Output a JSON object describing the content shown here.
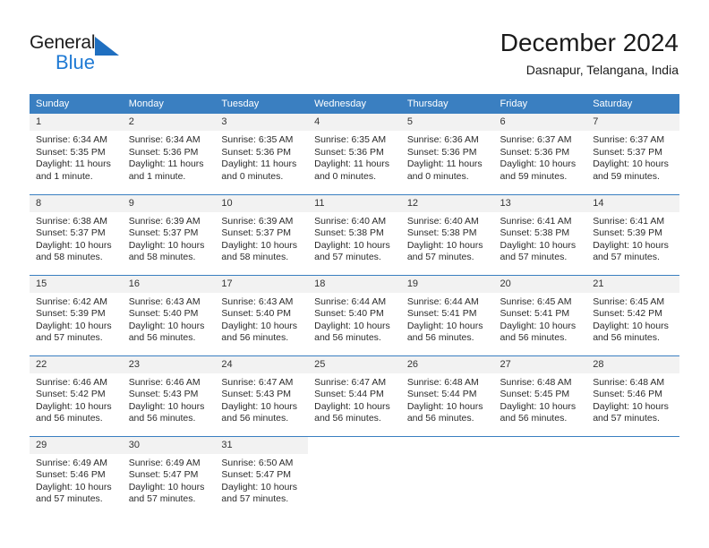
{
  "brand": {
    "name_part1": "General",
    "name_part2": "Blue",
    "accent_color": "#1f7ad4",
    "triangle_color": "#1f6fc0"
  },
  "header": {
    "month_title": "December 2024",
    "location": "Dasnapur, Telangana, India"
  },
  "calendar": {
    "header_bg": "#3a7fc1",
    "daynum_bg": "#f2f2f2",
    "weekday_labels": [
      "Sunday",
      "Monday",
      "Tuesday",
      "Wednesday",
      "Thursday",
      "Friday",
      "Saturday"
    ],
    "weeks": [
      [
        {
          "day": "1",
          "sunrise": "Sunrise: 6:34 AM",
          "sunset": "Sunset: 5:35 PM",
          "daylight_line1": "Daylight: 11 hours",
          "daylight_line2": "and 1 minute."
        },
        {
          "day": "2",
          "sunrise": "Sunrise: 6:34 AM",
          "sunset": "Sunset: 5:36 PM",
          "daylight_line1": "Daylight: 11 hours",
          "daylight_line2": "and 1 minute."
        },
        {
          "day": "3",
          "sunrise": "Sunrise: 6:35 AM",
          "sunset": "Sunset: 5:36 PM",
          "daylight_line1": "Daylight: 11 hours",
          "daylight_line2": "and 0 minutes."
        },
        {
          "day": "4",
          "sunrise": "Sunrise: 6:35 AM",
          "sunset": "Sunset: 5:36 PM",
          "daylight_line1": "Daylight: 11 hours",
          "daylight_line2": "and 0 minutes."
        },
        {
          "day": "5",
          "sunrise": "Sunrise: 6:36 AM",
          "sunset": "Sunset: 5:36 PM",
          "daylight_line1": "Daylight: 11 hours",
          "daylight_line2": "and 0 minutes."
        },
        {
          "day": "6",
          "sunrise": "Sunrise: 6:37 AM",
          "sunset": "Sunset: 5:36 PM",
          "daylight_line1": "Daylight: 10 hours",
          "daylight_line2": "and 59 minutes."
        },
        {
          "day": "7",
          "sunrise": "Sunrise: 6:37 AM",
          "sunset": "Sunset: 5:37 PM",
          "daylight_line1": "Daylight: 10 hours",
          "daylight_line2": "and 59 minutes."
        }
      ],
      [
        {
          "day": "8",
          "sunrise": "Sunrise: 6:38 AM",
          "sunset": "Sunset: 5:37 PM",
          "daylight_line1": "Daylight: 10 hours",
          "daylight_line2": "and 58 minutes."
        },
        {
          "day": "9",
          "sunrise": "Sunrise: 6:39 AM",
          "sunset": "Sunset: 5:37 PM",
          "daylight_line1": "Daylight: 10 hours",
          "daylight_line2": "and 58 minutes."
        },
        {
          "day": "10",
          "sunrise": "Sunrise: 6:39 AM",
          "sunset": "Sunset: 5:37 PM",
          "daylight_line1": "Daylight: 10 hours",
          "daylight_line2": "and 58 minutes."
        },
        {
          "day": "11",
          "sunrise": "Sunrise: 6:40 AM",
          "sunset": "Sunset: 5:38 PM",
          "daylight_line1": "Daylight: 10 hours",
          "daylight_line2": "and 57 minutes."
        },
        {
          "day": "12",
          "sunrise": "Sunrise: 6:40 AM",
          "sunset": "Sunset: 5:38 PM",
          "daylight_line1": "Daylight: 10 hours",
          "daylight_line2": "and 57 minutes."
        },
        {
          "day": "13",
          "sunrise": "Sunrise: 6:41 AM",
          "sunset": "Sunset: 5:38 PM",
          "daylight_line1": "Daylight: 10 hours",
          "daylight_line2": "and 57 minutes."
        },
        {
          "day": "14",
          "sunrise": "Sunrise: 6:41 AM",
          "sunset": "Sunset: 5:39 PM",
          "daylight_line1": "Daylight: 10 hours",
          "daylight_line2": "and 57 minutes."
        }
      ],
      [
        {
          "day": "15",
          "sunrise": "Sunrise: 6:42 AM",
          "sunset": "Sunset: 5:39 PM",
          "daylight_line1": "Daylight: 10 hours",
          "daylight_line2": "and 57 minutes."
        },
        {
          "day": "16",
          "sunrise": "Sunrise: 6:43 AM",
          "sunset": "Sunset: 5:40 PM",
          "daylight_line1": "Daylight: 10 hours",
          "daylight_line2": "and 56 minutes."
        },
        {
          "day": "17",
          "sunrise": "Sunrise: 6:43 AM",
          "sunset": "Sunset: 5:40 PM",
          "daylight_line1": "Daylight: 10 hours",
          "daylight_line2": "and 56 minutes."
        },
        {
          "day": "18",
          "sunrise": "Sunrise: 6:44 AM",
          "sunset": "Sunset: 5:40 PM",
          "daylight_line1": "Daylight: 10 hours",
          "daylight_line2": "and 56 minutes."
        },
        {
          "day": "19",
          "sunrise": "Sunrise: 6:44 AM",
          "sunset": "Sunset: 5:41 PM",
          "daylight_line1": "Daylight: 10 hours",
          "daylight_line2": "and 56 minutes."
        },
        {
          "day": "20",
          "sunrise": "Sunrise: 6:45 AM",
          "sunset": "Sunset: 5:41 PM",
          "daylight_line1": "Daylight: 10 hours",
          "daylight_line2": "and 56 minutes."
        },
        {
          "day": "21",
          "sunrise": "Sunrise: 6:45 AM",
          "sunset": "Sunset: 5:42 PM",
          "daylight_line1": "Daylight: 10 hours",
          "daylight_line2": "and 56 minutes."
        }
      ],
      [
        {
          "day": "22",
          "sunrise": "Sunrise: 6:46 AM",
          "sunset": "Sunset: 5:42 PM",
          "daylight_line1": "Daylight: 10 hours",
          "daylight_line2": "and 56 minutes."
        },
        {
          "day": "23",
          "sunrise": "Sunrise: 6:46 AM",
          "sunset": "Sunset: 5:43 PM",
          "daylight_line1": "Daylight: 10 hours",
          "daylight_line2": "and 56 minutes."
        },
        {
          "day": "24",
          "sunrise": "Sunrise: 6:47 AM",
          "sunset": "Sunset: 5:43 PM",
          "daylight_line1": "Daylight: 10 hours",
          "daylight_line2": "and 56 minutes."
        },
        {
          "day": "25",
          "sunrise": "Sunrise: 6:47 AM",
          "sunset": "Sunset: 5:44 PM",
          "daylight_line1": "Daylight: 10 hours",
          "daylight_line2": "and 56 minutes."
        },
        {
          "day": "26",
          "sunrise": "Sunrise: 6:48 AM",
          "sunset": "Sunset: 5:44 PM",
          "daylight_line1": "Daylight: 10 hours",
          "daylight_line2": "and 56 minutes."
        },
        {
          "day": "27",
          "sunrise": "Sunrise: 6:48 AM",
          "sunset": "Sunset: 5:45 PM",
          "daylight_line1": "Daylight: 10 hours",
          "daylight_line2": "and 56 minutes."
        },
        {
          "day": "28",
          "sunrise": "Sunrise: 6:48 AM",
          "sunset": "Sunset: 5:46 PM",
          "daylight_line1": "Daylight: 10 hours",
          "daylight_line2": "and 57 minutes."
        }
      ],
      [
        {
          "day": "29",
          "sunrise": "Sunrise: 6:49 AM",
          "sunset": "Sunset: 5:46 PM",
          "daylight_line1": "Daylight: 10 hours",
          "daylight_line2": "and 57 minutes."
        },
        {
          "day": "30",
          "sunrise": "Sunrise: 6:49 AM",
          "sunset": "Sunset: 5:47 PM",
          "daylight_line1": "Daylight: 10 hours",
          "daylight_line2": "and 57 minutes."
        },
        {
          "day": "31",
          "sunrise": "Sunrise: 6:50 AM",
          "sunset": "Sunset: 5:47 PM",
          "daylight_line1": "Daylight: 10 hours",
          "daylight_line2": "and 57 minutes."
        },
        {
          "day": "",
          "sunrise": "",
          "sunset": "",
          "daylight_line1": "",
          "daylight_line2": ""
        },
        {
          "day": "",
          "sunrise": "",
          "sunset": "",
          "daylight_line1": "",
          "daylight_line2": ""
        },
        {
          "day": "",
          "sunrise": "",
          "sunset": "",
          "daylight_line1": "",
          "daylight_line2": ""
        },
        {
          "day": "",
          "sunrise": "",
          "sunset": "",
          "daylight_line1": "",
          "daylight_line2": ""
        }
      ]
    ]
  }
}
